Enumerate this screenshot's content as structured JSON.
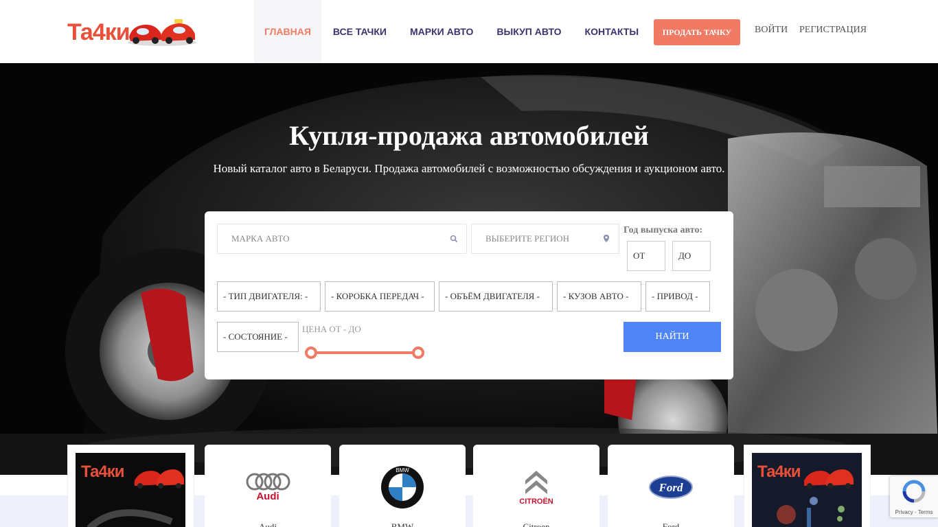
{
  "colors": {
    "accent": "#f07a63",
    "nav_text": "#3a3470",
    "find_button": "#5085f6",
    "logo_red": "#e8503a"
  },
  "header": {
    "logo_text": "Та4ки",
    "nav": [
      {
        "label": "ГЛАВНАЯ",
        "active": true
      },
      {
        "label": "ВСЕ ТАЧКИ",
        "active": false
      },
      {
        "label": "МАРКИ АВТО",
        "active": false
      },
      {
        "label": "ВЫКУП АВТО",
        "active": false
      },
      {
        "label": "КОНТАКТЫ",
        "active": false
      }
    ],
    "sell_button": "ПРОДАТЬ ТАЧКУ",
    "login": "ВОЙТИ",
    "register": "РЕГИСТРАЦИЯ"
  },
  "hero": {
    "title": "Купля-продажа автомобилей",
    "subtitle": "Новый каталог авто в Беларуси. Продажа автомобилей с возможностью обсуждения и аукционом авто."
  },
  "search": {
    "brand_placeholder": "МАРКА АВТО",
    "brand_icon": "search-icon",
    "region_placeholder": "ВЫБЕРИТЕ РЕГИОН",
    "region_icon": "map-pin-icon",
    "year_label": "Год выпуска авто:",
    "year_from": "ОТ",
    "year_to": "ДО",
    "selects": {
      "engine_type": "- ТИП ДВИГАТЕЛЯ: -",
      "gearbox": "- КОРОБКА ПЕРЕДАЧ -",
      "engine_volume": "- ОБЪЁМ ДВИГАТЕЛЯ -",
      "body": "- КУЗОВ АВТО -",
      "drive": "- ПРИВОД -",
      "condition": "- СОСТОЯНИЕ -"
    },
    "price_label": "ЦЕНА ОТ - ДО",
    "price_range": {
      "min_fraction": 0,
      "max_fraction": 1
    },
    "find_button": "НАЙТИ"
  },
  "brands": [
    {
      "name": "Audi",
      "logo": "audi-logo-icon"
    },
    {
      "name": "BMW",
      "logo": "bmw-logo-icon"
    },
    {
      "name": "Citroen",
      "logo": "citroen-logo-icon"
    },
    {
      "name": "Ford",
      "logo": "ford-logo-icon"
    }
  ],
  "brand_logo_text": {
    "audi": "Audi",
    "bmw": "BMW",
    "citroen": "CITROËN",
    "ford": "Ford"
  },
  "promos": [
    {
      "text": "Та4ки"
    },
    {
      "text": "Та4ки"
    }
  ],
  "recaptcha": {
    "privacy": "Privacy",
    "terms": "Terms",
    "separator": " - "
  }
}
